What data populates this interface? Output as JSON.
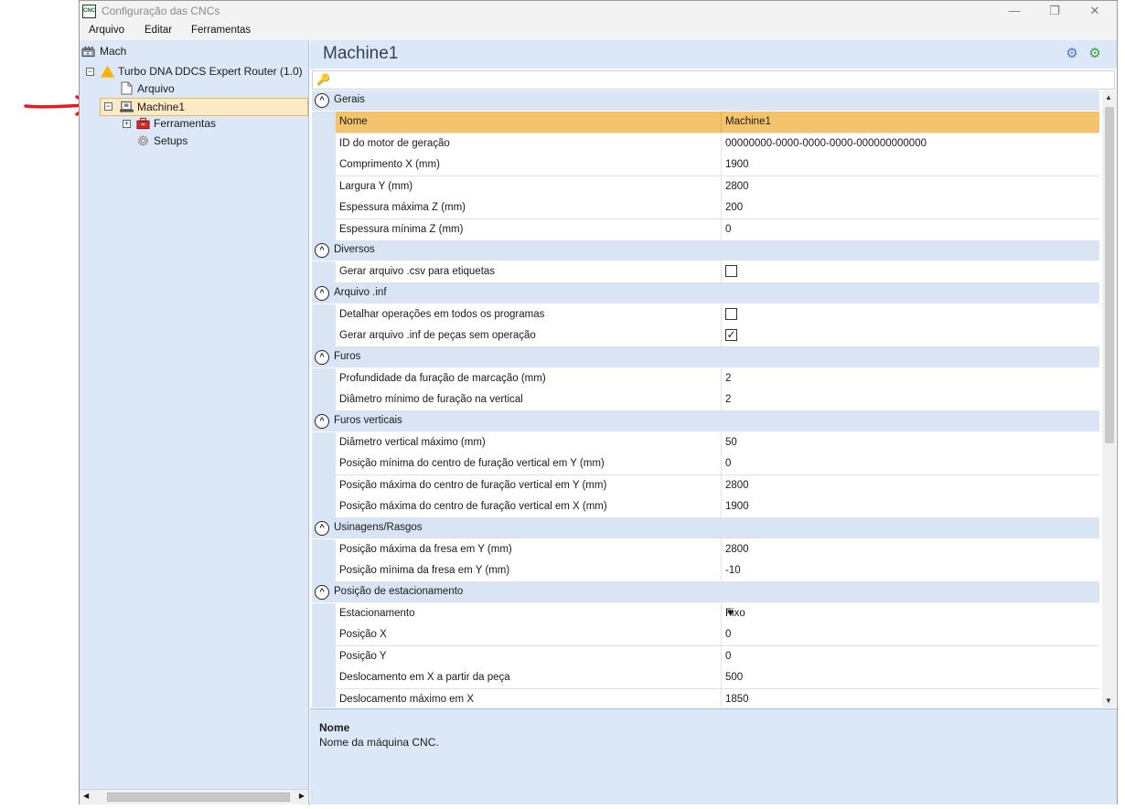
{
  "window": {
    "title": "Configuração das CNCs",
    "app_icon": "CNC",
    "controls": {
      "minimize": "—",
      "restore": "❐",
      "close": "✕"
    }
  },
  "menu": [
    "Arquivo",
    "Editar",
    "Ferramentas"
  ],
  "tree": {
    "root": "Mach",
    "controller": "Turbo DNA DDCS Expert Router (1.0)",
    "arquivo": "Arquivo",
    "machine": "Machine1",
    "ferramentas": "Ferramentas",
    "setups": "Setups"
  },
  "header": {
    "title": "Machine1"
  },
  "categories": [
    {
      "label": "Gerais",
      "rows": [
        {
          "name": "Nome",
          "value": "Machine1",
          "selected": true
        },
        {
          "name": "ID do motor de geração",
          "value": "00000000-0000-0000-0000-000000000000"
        },
        {
          "name": "Comprimento X (mm)",
          "value": "1900"
        },
        {
          "name": "Largura Y (mm)",
          "value": "2800"
        },
        {
          "name": "Espessura máxima Z (mm)",
          "value": "200"
        },
        {
          "name": "Espessura mínima Z (mm)",
          "value": "0"
        }
      ]
    },
    {
      "label": "Diversos",
      "rows": [
        {
          "name": "Gerar arquivo .csv para etiquetas",
          "checkbox": false
        }
      ]
    },
    {
      "label": "Arquivo .inf",
      "rows": [
        {
          "name": "Detalhar operações em todos os programas",
          "checkbox": false
        },
        {
          "name": "Gerar arquivo .inf de peças sem operação",
          "checkbox": true
        }
      ]
    },
    {
      "label": "Furos",
      "rows": [
        {
          "name": "Profundidade da furação de marcação (mm)",
          "value": "2"
        },
        {
          "name": "Diâmetro mínimo de furação na vertical",
          "value": "2"
        }
      ]
    },
    {
      "label": "Furos verticais",
      "rows": [
        {
          "name": "Diâmetro vertical máximo (mm)",
          "value": "50"
        },
        {
          "name": "Posição mínima do centro de furação vertical em Y (mm)",
          "value": "0"
        },
        {
          "name": "Posição máxima do centro de furação vertical em Y (mm)",
          "value": "2800"
        },
        {
          "name": "Posição máxima do centro de furação vertical em X (mm)",
          "value": "1900"
        }
      ]
    },
    {
      "label": "Usinagens/Rasgos",
      "rows": [
        {
          "name": "Posição máxima da fresa em Y (mm)",
          "value": "2800"
        },
        {
          "name": "Posição mínima da fresa em Y (mm)",
          "value": "-10"
        }
      ]
    },
    {
      "label": "Posição de estacionamento",
      "rows": [
        {
          "name": "Estacionamento",
          "value": "Fixo",
          "dropdown": true
        },
        {
          "name": "Posição X",
          "value": "0"
        },
        {
          "name": "Posição Y",
          "value": "0"
        },
        {
          "name": "Deslocamento em X a partir da peça",
          "value": "500"
        },
        {
          "name": "Deslocamento máximo em X",
          "value": "1850"
        }
      ]
    }
  ],
  "description": {
    "title": "Nome",
    "text": "Nome da máquina CNC."
  },
  "colors": {
    "selected_row": "#f5c36b",
    "pane_bg": "#dce8f7",
    "annotation_arrow": "#e8191c"
  },
  "icons": [
    "machine-icon",
    "warning-icon",
    "document-icon",
    "toolbox-icon",
    "gear-icon",
    "key-icon",
    "arrow-annotation"
  ]
}
